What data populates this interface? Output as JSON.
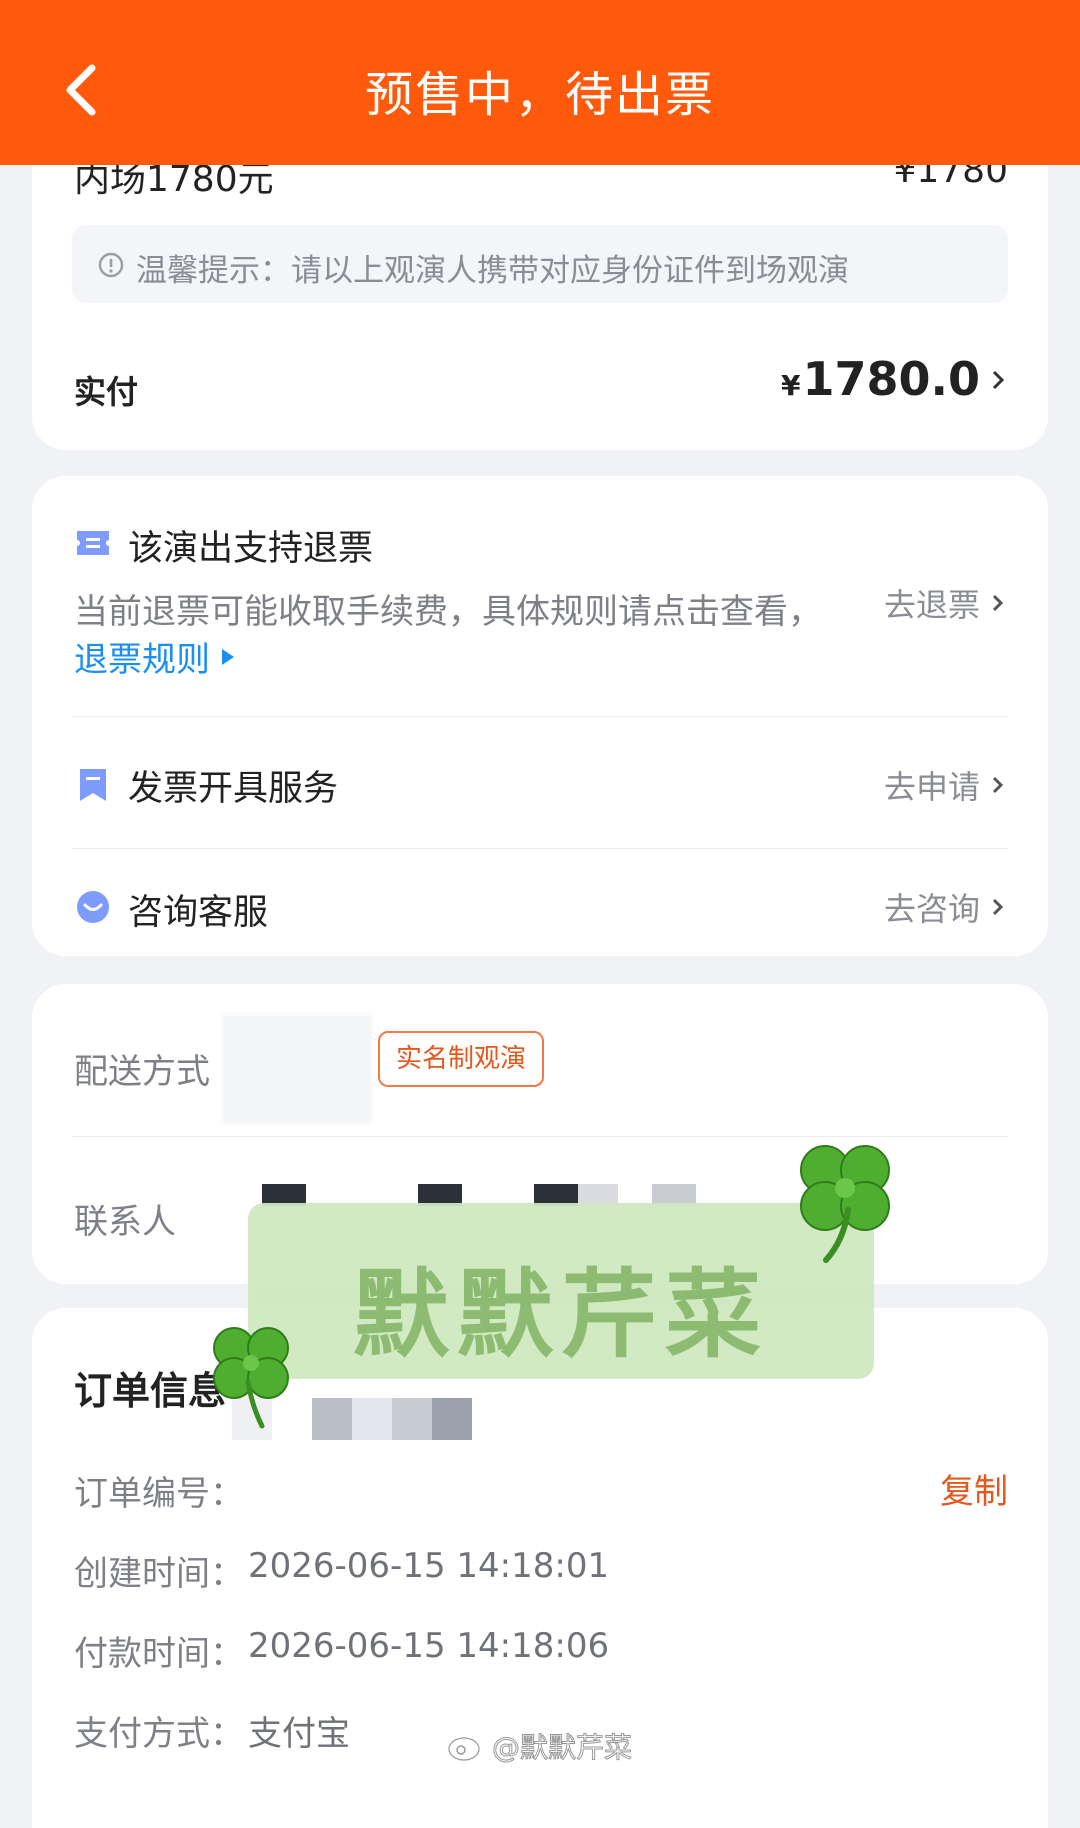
{
  "header": {
    "title": "预售中，待出票"
  },
  "price_card": {
    "ticket_label": "内场1780元",
    "ticket_price": "¥1780",
    "tip": "温馨提示：请以上观演人携带对应身份证件到场观演",
    "paid_label": "实付",
    "paid_currency": "¥",
    "paid_amount": "1780.0"
  },
  "service_card": {
    "refund_title": "该演出支持退票",
    "refund_desc": "当前退票可能收取手续费，具体规则请点击查看，",
    "refund_rule_link": "退票规则",
    "refund_action": "去退票",
    "invoice_title": "发票开具服务",
    "invoice_action": "去申请",
    "support_title": "咨询客服",
    "support_action": "去咨询"
  },
  "delivery_card": {
    "delivery_label": "配送方式",
    "real_name_badge": "实名制观演",
    "contact_label": "联系人"
  },
  "watermark": {
    "text": "默默芹菜",
    "weibo_handle": "@默默芹菜"
  },
  "order_card": {
    "title": "订单信息",
    "order_no_label": "订单编号：",
    "copy_label": "复制",
    "created_label": "创建时间：",
    "created_value": "2026-06-15 14:18:01",
    "paid_label": "付款时间：",
    "paid_value": "2026-06-15 14:18:06",
    "pay_method_label": "支付方式：",
    "pay_method_value": "支付宝"
  },
  "colors": {
    "brand": "#ff5a0c",
    "link": "#1a8ff0",
    "accent_text": "#e5581c",
    "icon": "#7e9cff"
  },
  "icons": [
    "back-arrow-icon",
    "info-icon",
    "chevron-right-icon",
    "ticket-icon",
    "bookmark-icon",
    "chat-icon",
    "clover-icon",
    "weibo-icon"
  ]
}
